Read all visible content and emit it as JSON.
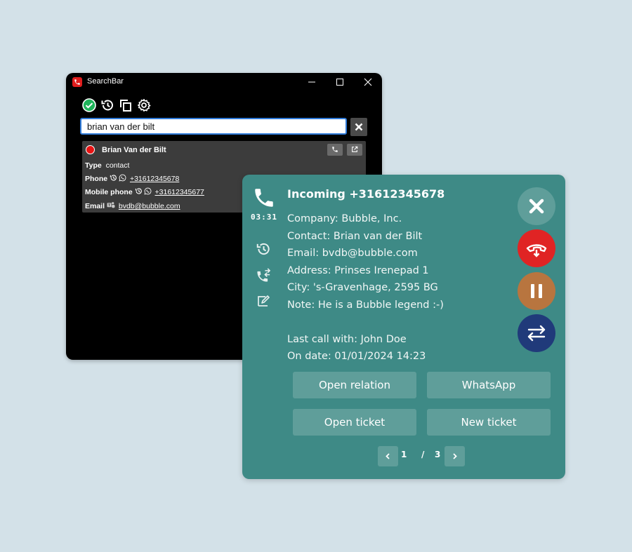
{
  "searchbar": {
    "title": "SearchBar",
    "toolbar_icons": [
      "check-circle-icon",
      "history-icon",
      "copy-icon",
      "gear-icon"
    ],
    "search_value": "brian van der bilt",
    "result": {
      "name": "Brian Van der Bilt",
      "type_label": "Type",
      "type_value": "contact",
      "phone_label": "Phone",
      "phone_value": "+31612345678",
      "mobile_label": "Mobile phone",
      "mobile_value": "+31612345677",
      "email_label": "Email",
      "email_value": "bvdb@bubble.com"
    }
  },
  "call": {
    "title": "Incoming +31612345678",
    "timer": "03:31",
    "info": {
      "company": "Company: Bubble, Inc.",
      "contact": "Contact: Brian van der Bilt",
      "email": "Email: bvdb@bubble.com",
      "address": "Address: Prinses Irenepad 1",
      "city": "City: 's-Gravenhage, 2595 BG",
      "note": "Note: He is a Bubble legend :-)",
      "last_call": "Last call with: John Doe",
      "on_date": "On date: 01/01/2024 14:23"
    },
    "actions": {
      "open_relation": "Open relation",
      "whatsapp": "WhatsApp",
      "open_ticket": "Open ticket",
      "new_ticket": "New ticket"
    },
    "pager": {
      "current": "1",
      "separator": "/",
      "total": "3"
    },
    "colors": {
      "panel": "#3e8a86",
      "close": "#5f9e9a",
      "hangup": "#e02424",
      "hold": "#b8753f",
      "transfer": "#203a7a"
    }
  }
}
